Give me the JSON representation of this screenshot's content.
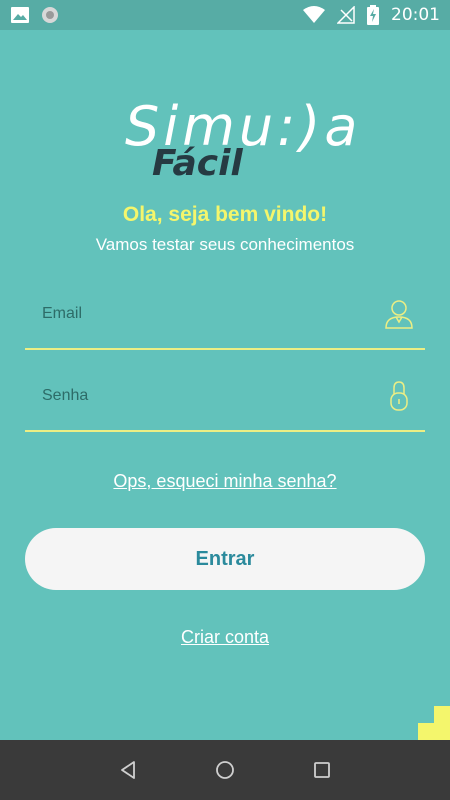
{
  "status_bar": {
    "time": "20:01",
    "icons": [
      "image-notification-icon",
      "sync-notification-icon",
      "wifi-icon",
      "no-signal-icon",
      "battery-charging-icon"
    ]
  },
  "logo": {
    "top": "Simu:)a",
    "bottom": "Fácil"
  },
  "welcome": {
    "title": "Ola, seja bem vindo!",
    "subtitle": "Vamos testar seus conhecimentos"
  },
  "form": {
    "email_placeholder": "Email",
    "email_value": "",
    "password_placeholder": "Senha",
    "password_value": "",
    "forgot_password": "Ops, esqueci minha senha?",
    "submit_label": "Entrar",
    "create_account": "Criar conta"
  },
  "colors": {
    "background": "#62c2bb",
    "accent_yellow": "#f4f66c",
    "button_text": "#2b8a9c",
    "logo_dark": "#263a42"
  },
  "nav_bar": {
    "buttons": [
      "back-icon",
      "home-icon",
      "recents-icon"
    ]
  }
}
